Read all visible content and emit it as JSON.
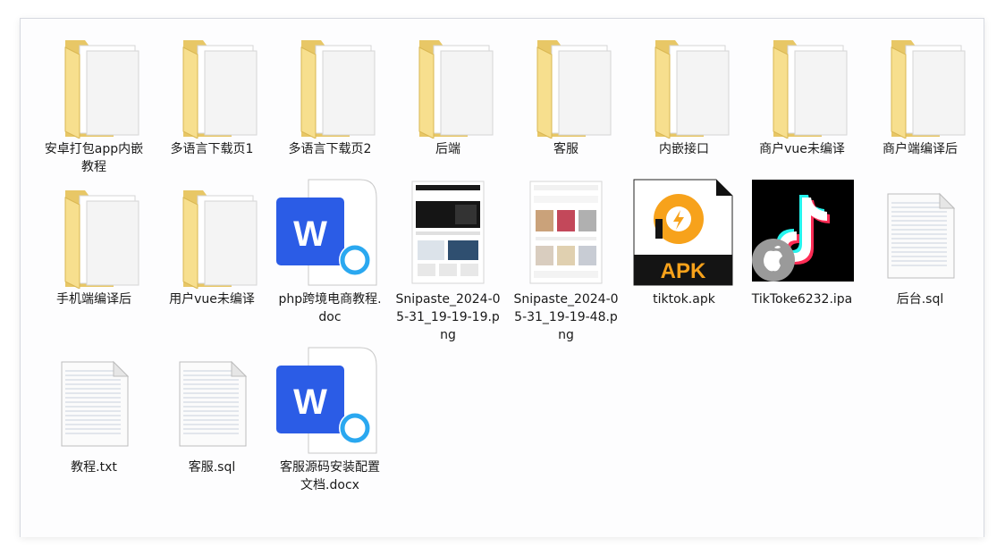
{
  "explorer": {
    "items": [
      {
        "name": "安卓打包app内嵌教程",
        "type": "folder",
        "icon": "folder-icon"
      },
      {
        "name": "多语言下载页1",
        "type": "folder",
        "icon": "folder-icon"
      },
      {
        "name": "多语言下载页2",
        "type": "folder",
        "icon": "folder-icon"
      },
      {
        "name": "后端",
        "type": "folder",
        "icon": "folder-icon"
      },
      {
        "name": "客服",
        "type": "folder",
        "icon": "folder-icon"
      },
      {
        "name": "内嵌接口",
        "type": "folder",
        "icon": "folder-icon"
      },
      {
        "name": "商户vue未编译",
        "type": "folder",
        "icon": "folder-icon"
      },
      {
        "name": "商户端编译后",
        "type": "folder",
        "icon": "folder-icon"
      },
      {
        "name": "手机端编译后",
        "type": "folder",
        "icon": "folder-icon"
      },
      {
        "name": "用户vue未编译",
        "type": "folder",
        "icon": "folder-icon"
      },
      {
        "name": "php跨境电商教程.doc",
        "type": "word",
        "icon": "word-document-icon",
        "badge_text": "W"
      },
      {
        "name": "Snipaste_2024-05-31_19-19-19.png",
        "type": "image",
        "icon": "screenshot-thumbnail-icon"
      },
      {
        "name": "Snipaste_2024-05-31_19-19-48.png",
        "type": "image",
        "icon": "screenshot-thumbnail-icon"
      },
      {
        "name": "tiktok.apk",
        "type": "apk",
        "icon": "apk-icon",
        "badge_text": "APK"
      },
      {
        "name": "TikToke6232.ipa",
        "type": "ipa",
        "icon": "tiktok-ipa-icon"
      },
      {
        "name": "后台.sql",
        "type": "text",
        "icon": "text-file-icon"
      },
      {
        "name": "教程.txt",
        "type": "text",
        "icon": "text-file-icon"
      },
      {
        "name": "客服.sql",
        "type": "text",
        "icon": "text-file-icon"
      },
      {
        "name": "客服源码安装配置文档.docx",
        "type": "word",
        "icon": "word-document-icon",
        "badge_text": "W"
      }
    ]
  },
  "colors": {
    "folder_back": "#e8c766",
    "folder_front": "#f7df8e",
    "word_blue": "#2b5ce6",
    "apk_orange": "#f7a21b",
    "tiktok_cyan": "#25f4ee",
    "tiktok_red": "#fe2c55"
  }
}
